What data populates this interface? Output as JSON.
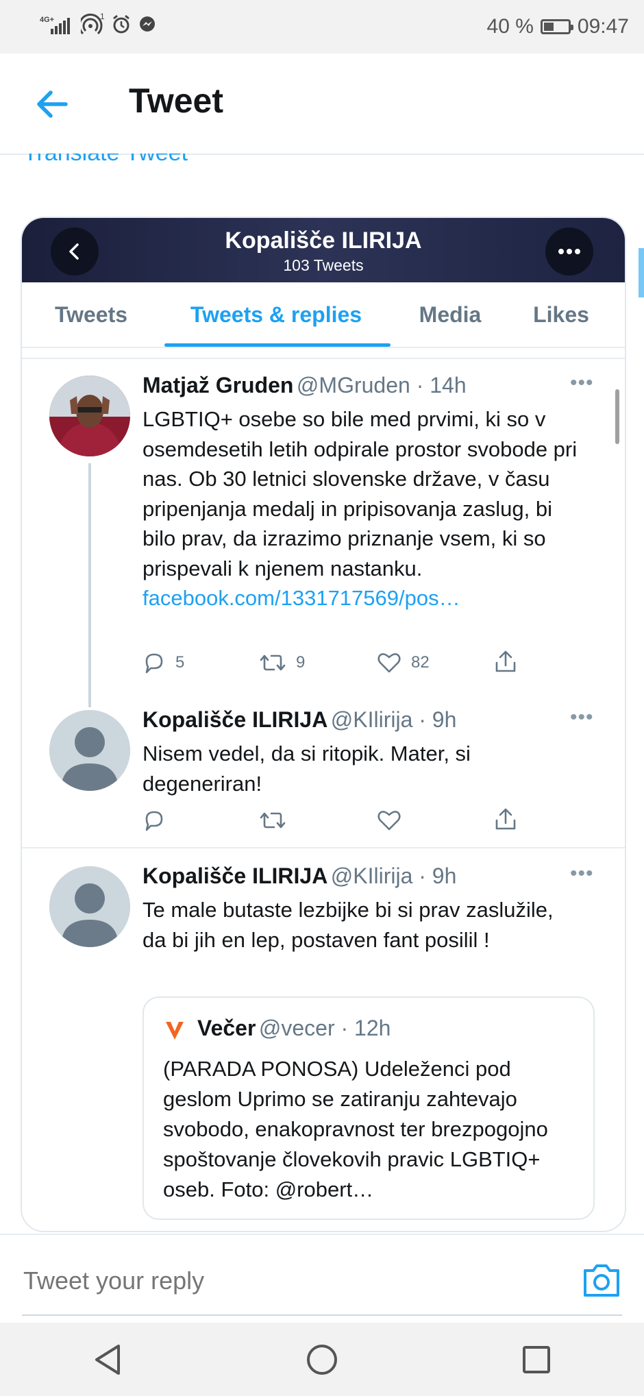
{
  "status_bar": {
    "network": "4G+",
    "battery": "40 %",
    "battery_level": 0.4,
    "time": "09:47",
    "notification_count": "1"
  },
  "header": {
    "title": "Tweet"
  },
  "translate_link": "Translate Tweet",
  "embedded": {
    "profile": {
      "name": "Kopališče ILIRIJA",
      "tweet_count": "103 Tweets"
    },
    "tabs": [
      {
        "label": "Tweets",
        "active": false
      },
      {
        "label": "Tweets & replies",
        "active": true
      },
      {
        "label": "Media",
        "active": false
      },
      {
        "label": "Likes",
        "active": false
      }
    ],
    "tweets": [
      {
        "name": "Matjaž Gruden",
        "handle": "@MGruden",
        "time": "14h",
        "text": "LGBTIQ+ osebe so bile med prvimi, ki so v osemdesetih letih odpirale prostor svobode pri nas. Ob 30 letnici slovenske države, v času pripenjanja medalj in pripisovanja zaslug,  bi bilo prav, da izrazimo priznanje vsem, ki so prispevali k njenem nastanku.",
        "link": "facebook.com/1331717569/pos…",
        "replies": "5",
        "retweets": "9",
        "likes": "82"
      },
      {
        "name": "Kopališče ILIRIJA",
        "handle": "@KIlirija",
        "time": "9h",
        "text": "Nisem vedel, da si ritopik. Mater, si degeneriran!"
      },
      {
        "name": "Kopališče ILIRIJA",
        "handle": "@KIlirija",
        "time": "9h",
        "text": "Te male butaste lezbijke bi si prav zaslužile, da bi jih en lep, postaven fant posilil !",
        "quote": {
          "name": "Večer",
          "handle": "@vecer",
          "time": "12h",
          "text": "(PARADA PONOSA) Udeleženci pod geslom Uprimo se zatiranju zahtevajo svobodo, enakopravnost ter brezpogojno spoštovanje človekovih pravic LGBTIQ+ oseb. Foto: @robert…"
        }
      }
    ]
  },
  "reply": {
    "placeholder": "Tweet your reply"
  },
  "colors": {
    "accent": "#1da1f2",
    "text": "#14171a",
    "muted": "#657786",
    "banner": "#1b1f3b"
  }
}
